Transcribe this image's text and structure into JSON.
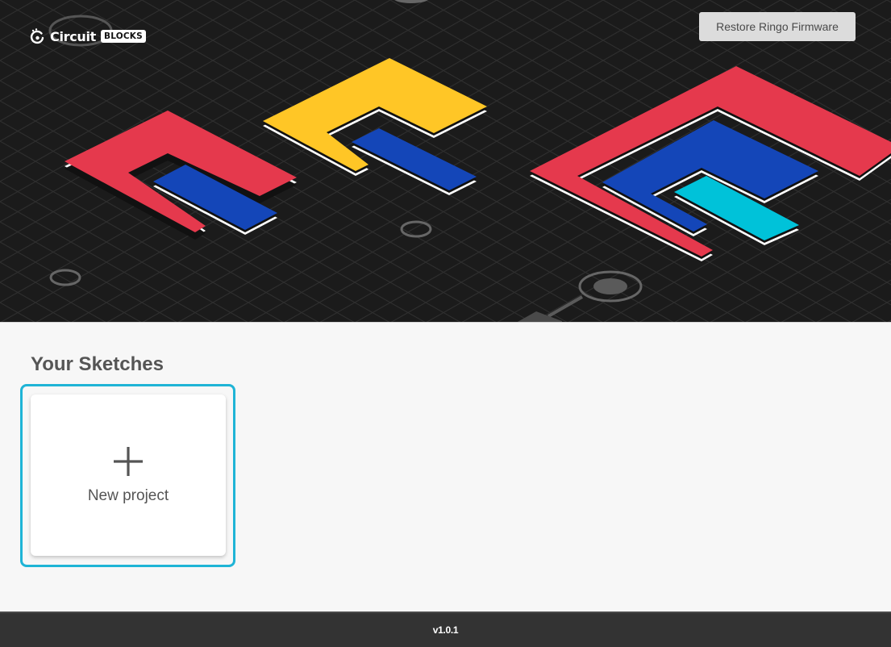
{
  "app": {
    "logo_text": "Circuit",
    "logo_badge": "BLOCKS"
  },
  "header": {
    "restore_button_label": "Restore Ringo Firmware"
  },
  "sketches": {
    "title": "Your Sketches",
    "new_project_label": "New project"
  },
  "footer": {
    "version": "v1.0.1"
  },
  "colors": {
    "hero_background": "#1b1b1b",
    "red": "#e5394d",
    "yellow": "#ffc626",
    "blue": "#1446b8",
    "cyan": "#00c2d9",
    "focus_ring": "#1fb4d6",
    "footer_background": "#333333"
  },
  "icons": {
    "logo": "circuit-logo-icon",
    "new_project": "plus-icon"
  }
}
